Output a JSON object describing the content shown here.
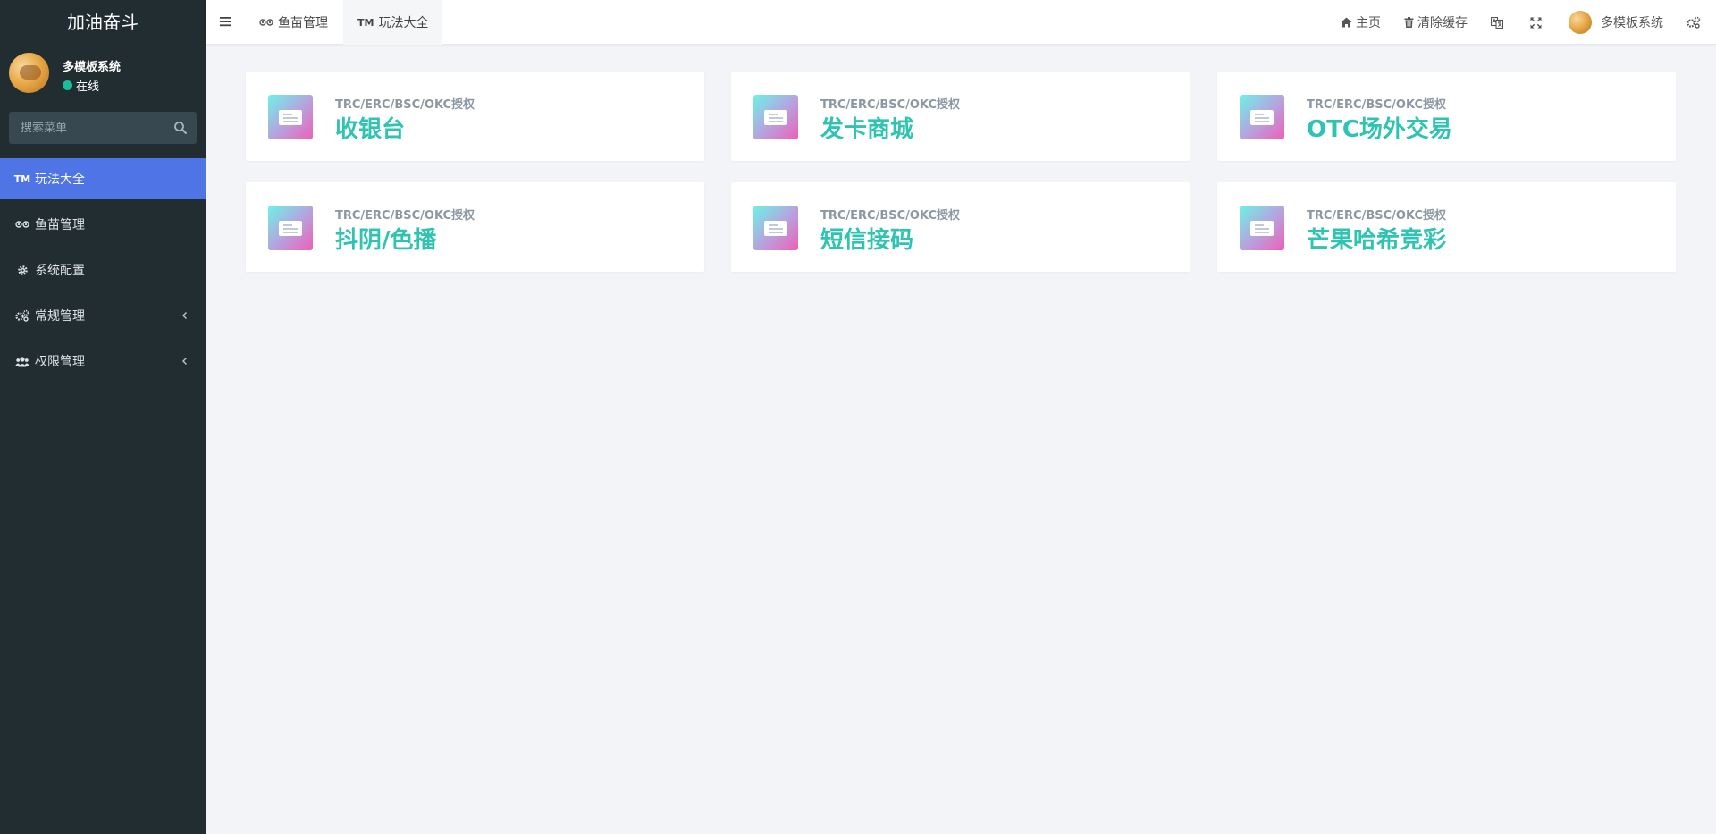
{
  "sidebar": {
    "brand": "加油奋斗",
    "user": {
      "name": "多模板系统",
      "status": "在线"
    },
    "search": {
      "placeholder": "搜索菜单"
    },
    "menu": [
      {
        "label": "玩法大全",
        "icon": "tm-icon",
        "active": true
      },
      {
        "label": "鱼苗管理",
        "icon": "eye-glasses-icon"
      },
      {
        "label": "系统配置",
        "icon": "gear-icon"
      },
      {
        "label": "常规管理",
        "icon": "cogs-icon",
        "has_children": true
      },
      {
        "label": "权限管理",
        "icon": "users-icon",
        "has_children": true
      }
    ]
  },
  "header": {
    "tabs": [
      {
        "label": "鱼苗管理",
        "icon": "eye-glasses-icon"
      },
      {
        "label": "玩法大全",
        "icon": "tm-icon",
        "active": true
      }
    ],
    "right": {
      "home": "主页",
      "clear_cache": "清除缓存",
      "username": "多模板系统"
    }
  },
  "cards": [
    {
      "tag": "TRC/ERC/BSC/OKC授权",
      "title": "收银台"
    },
    {
      "tag": "TRC/ERC/BSC/OKC授权",
      "title": "发卡商城"
    },
    {
      "tag": "TRC/ERC/BSC/OKC授权",
      "title": "OTC场外交易"
    },
    {
      "tag": "TRC/ERC/BSC/OKC授权",
      "title": "抖阴/色播"
    },
    {
      "tag": "TRC/ERC/BSC/OKC授权",
      "title": "短信接码"
    },
    {
      "tag": "TRC/ERC/BSC/OKC授权",
      "title": "芒果哈希竞彩"
    }
  ],
  "colors": {
    "sidebar_bg": "#222d32",
    "active_menu": "#4f74e6",
    "card_title": "#2fc4b2",
    "online_dot": "#1abc9c"
  }
}
